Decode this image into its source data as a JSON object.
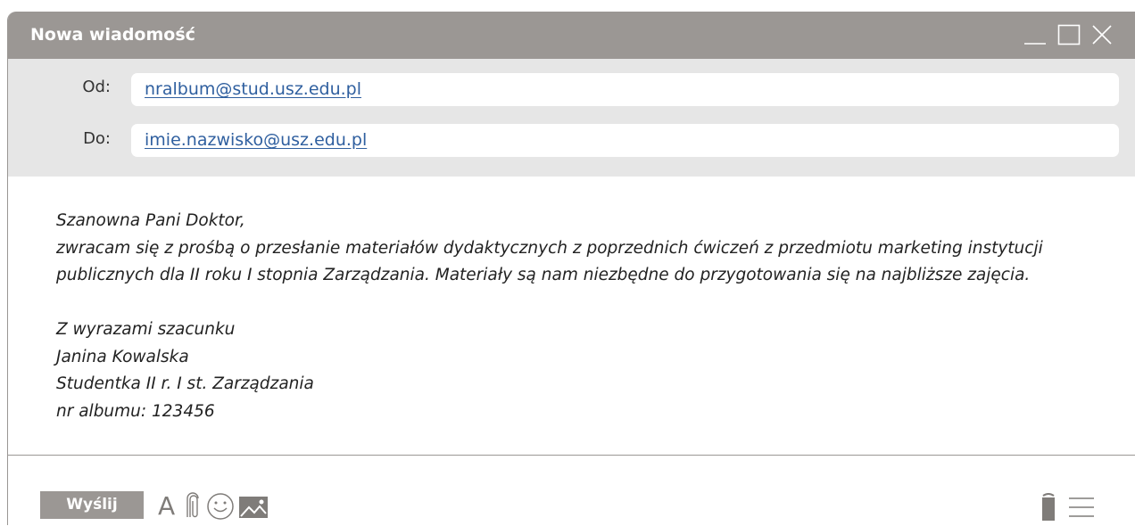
{
  "window": {
    "title": "Nowa wiadomość",
    "controls": [
      "minimize-icon",
      "maximize-icon",
      "close-icon"
    ]
  },
  "headers": {
    "from_label": "Od:",
    "from_value": "nralbum@stud.usz.edu.pl",
    "to_label": "Do:",
    "to_value": "imie.nazwisko@usz.edu.pl"
  },
  "body": {
    "greeting": "Szanowna Pani Doktor,",
    "line1": "zwracam się z prośbą o przesłanie materiałów dydaktycznych z poprzednich ćwiczeń z przedmiotu marketing instytucji",
    "line2": "publicznych dla II roku I stopnia Zarządzania. Materiały są nam niezbędne do przygotowania się na najbliższe zajęcia.",
    "closing": "Z wyrazami szacunku",
    "name": "Janina Kowalska",
    "role": "Studentka II r. I st. Zarządzania",
    "album": "nr albumu: 123456"
  },
  "toolbar": {
    "send_label": "Wyślij",
    "font_glyph": "A",
    "icons": [
      "font-icon",
      "paperclip-icon",
      "emoji-icon",
      "image-icon",
      "trash-icon",
      "menu-icon"
    ]
  },
  "colors": {
    "titlebar": "#9b9794",
    "header_bg": "#e6e6e6",
    "link": "#2f5f9f"
  }
}
